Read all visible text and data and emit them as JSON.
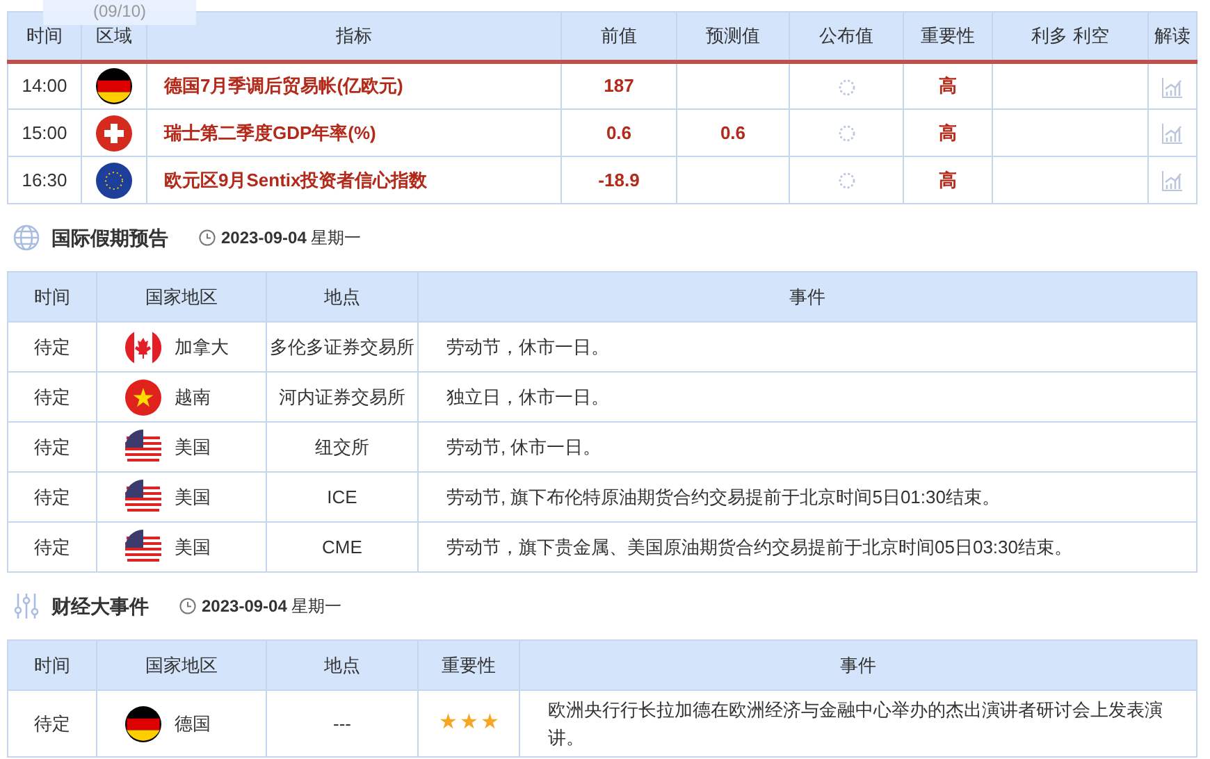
{
  "overlay_text": "(09/10)",
  "calendar": {
    "columns": [
      "时间",
      "区域",
      "指标",
      "前值",
      "预测值",
      "公布值",
      "重要性",
      "利多 利空",
      "解读"
    ],
    "rows": [
      {
        "time": "14:00",
        "kind": "de",
        "indicator": "德国7月季调后贸易帐(亿欧元)",
        "previous": "187",
        "importance": "高"
      },
      {
        "time": "15:00",
        "kind": "ch",
        "indicator": "瑞士第二季度GDP年率(%)",
        "previous": "0.6",
        "forecast": "0.6",
        "importance": "高"
      },
      {
        "time": "16:30",
        "kind": "eu",
        "indicator": "欧元区9月Sentix投资者信心指数",
        "previous": "-18.9",
        "importance": "高"
      }
    ]
  },
  "holidays": {
    "title": "国际假期预告",
    "date": "**2023-09-04** 星期一",
    "columns": [
      "时间",
      "国家地区",
      "地点",
      "事件"
    ],
    "rows": [
      {
        "time": "待定",
        "kind": "ca",
        "country": "加拿大",
        "place": "多伦多证券交易所",
        "event": "劳动节，休市一日。"
      },
      {
        "time": "待定",
        "kind": "vn",
        "country": "越南",
        "place": "河内证券交易所",
        "event": "独立日，休市一日。"
      },
      {
        "time": "待定",
        "kind": "us",
        "country": "美国",
        "place": "纽交所",
        "event": "劳动节, 休市一日。"
      },
      {
        "time": "待定",
        "kind": "us",
        "country": "美国",
        "place": "ICE",
        "event": "劳动节, 旗下布伦特原油期货合约交易提前于北京时间5日01:30结束。"
      },
      {
        "time": "待定",
        "kind": "us",
        "country": "美国",
        "place": "CME",
        "event": "劳动节，旗下贵金属、美国原油期货合约交易提前于北京时间05日03:30结束。"
      }
    ]
  },
  "events": {
    "title": "财经大事件",
    "date": "**2023-09-04** 星期一",
    "columns": [
      "时间",
      "国家地区",
      "地点",
      "重要性",
      "事件"
    ],
    "rows": [
      {
        "time": "待定",
        "kind": "de",
        "country": "德国",
        "place": "---",
        "stars": 3,
        "event": "欧洲央行行长拉加德在欧洲经济与金融中心举办的杰出演讲者研讨会上发表演讲。"
      }
    ]
  }
}
